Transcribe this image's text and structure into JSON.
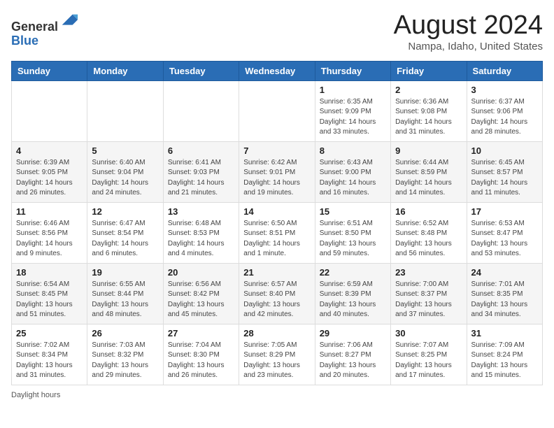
{
  "header": {
    "logo": {
      "line1": "General",
      "line2": "Blue"
    },
    "title": "August 2024",
    "location": "Nampa, Idaho, United States"
  },
  "days_of_week": [
    "Sunday",
    "Monday",
    "Tuesday",
    "Wednesday",
    "Thursday",
    "Friday",
    "Saturday"
  ],
  "weeks": [
    [
      {
        "day": "",
        "info": ""
      },
      {
        "day": "",
        "info": ""
      },
      {
        "day": "",
        "info": ""
      },
      {
        "day": "",
        "info": ""
      },
      {
        "day": "1",
        "info": "Sunrise: 6:35 AM\nSunset: 9:09 PM\nDaylight: 14 hours and 33 minutes."
      },
      {
        "day": "2",
        "info": "Sunrise: 6:36 AM\nSunset: 9:08 PM\nDaylight: 14 hours and 31 minutes."
      },
      {
        "day": "3",
        "info": "Sunrise: 6:37 AM\nSunset: 9:06 PM\nDaylight: 14 hours and 28 minutes."
      }
    ],
    [
      {
        "day": "4",
        "info": "Sunrise: 6:39 AM\nSunset: 9:05 PM\nDaylight: 14 hours and 26 minutes."
      },
      {
        "day": "5",
        "info": "Sunrise: 6:40 AM\nSunset: 9:04 PM\nDaylight: 14 hours and 24 minutes."
      },
      {
        "day": "6",
        "info": "Sunrise: 6:41 AM\nSunset: 9:03 PM\nDaylight: 14 hours and 21 minutes."
      },
      {
        "day": "7",
        "info": "Sunrise: 6:42 AM\nSunset: 9:01 PM\nDaylight: 14 hours and 19 minutes."
      },
      {
        "day": "8",
        "info": "Sunrise: 6:43 AM\nSunset: 9:00 PM\nDaylight: 14 hours and 16 minutes."
      },
      {
        "day": "9",
        "info": "Sunrise: 6:44 AM\nSunset: 8:59 PM\nDaylight: 14 hours and 14 minutes."
      },
      {
        "day": "10",
        "info": "Sunrise: 6:45 AM\nSunset: 8:57 PM\nDaylight: 14 hours and 11 minutes."
      }
    ],
    [
      {
        "day": "11",
        "info": "Sunrise: 6:46 AM\nSunset: 8:56 PM\nDaylight: 14 hours and 9 minutes."
      },
      {
        "day": "12",
        "info": "Sunrise: 6:47 AM\nSunset: 8:54 PM\nDaylight: 14 hours and 6 minutes."
      },
      {
        "day": "13",
        "info": "Sunrise: 6:48 AM\nSunset: 8:53 PM\nDaylight: 14 hours and 4 minutes."
      },
      {
        "day": "14",
        "info": "Sunrise: 6:50 AM\nSunset: 8:51 PM\nDaylight: 14 hours and 1 minute."
      },
      {
        "day": "15",
        "info": "Sunrise: 6:51 AM\nSunset: 8:50 PM\nDaylight: 13 hours and 59 minutes."
      },
      {
        "day": "16",
        "info": "Sunrise: 6:52 AM\nSunset: 8:48 PM\nDaylight: 13 hours and 56 minutes."
      },
      {
        "day": "17",
        "info": "Sunrise: 6:53 AM\nSunset: 8:47 PM\nDaylight: 13 hours and 53 minutes."
      }
    ],
    [
      {
        "day": "18",
        "info": "Sunrise: 6:54 AM\nSunset: 8:45 PM\nDaylight: 13 hours and 51 minutes."
      },
      {
        "day": "19",
        "info": "Sunrise: 6:55 AM\nSunset: 8:44 PM\nDaylight: 13 hours and 48 minutes."
      },
      {
        "day": "20",
        "info": "Sunrise: 6:56 AM\nSunset: 8:42 PM\nDaylight: 13 hours and 45 minutes."
      },
      {
        "day": "21",
        "info": "Sunrise: 6:57 AM\nSunset: 8:40 PM\nDaylight: 13 hours and 42 minutes."
      },
      {
        "day": "22",
        "info": "Sunrise: 6:59 AM\nSunset: 8:39 PM\nDaylight: 13 hours and 40 minutes."
      },
      {
        "day": "23",
        "info": "Sunrise: 7:00 AM\nSunset: 8:37 PM\nDaylight: 13 hours and 37 minutes."
      },
      {
        "day": "24",
        "info": "Sunrise: 7:01 AM\nSunset: 8:35 PM\nDaylight: 13 hours and 34 minutes."
      }
    ],
    [
      {
        "day": "25",
        "info": "Sunrise: 7:02 AM\nSunset: 8:34 PM\nDaylight: 13 hours and 31 minutes."
      },
      {
        "day": "26",
        "info": "Sunrise: 7:03 AM\nSunset: 8:32 PM\nDaylight: 13 hours and 29 minutes."
      },
      {
        "day": "27",
        "info": "Sunrise: 7:04 AM\nSunset: 8:30 PM\nDaylight: 13 hours and 26 minutes."
      },
      {
        "day": "28",
        "info": "Sunrise: 7:05 AM\nSunset: 8:29 PM\nDaylight: 13 hours and 23 minutes."
      },
      {
        "day": "29",
        "info": "Sunrise: 7:06 AM\nSunset: 8:27 PM\nDaylight: 13 hours and 20 minutes."
      },
      {
        "day": "30",
        "info": "Sunrise: 7:07 AM\nSunset: 8:25 PM\nDaylight: 13 hours and 17 minutes."
      },
      {
        "day": "31",
        "info": "Sunrise: 7:09 AM\nSunset: 8:24 PM\nDaylight: 13 hours and 15 minutes."
      }
    ]
  ],
  "footer": {
    "daylight_label": "Daylight hours"
  }
}
